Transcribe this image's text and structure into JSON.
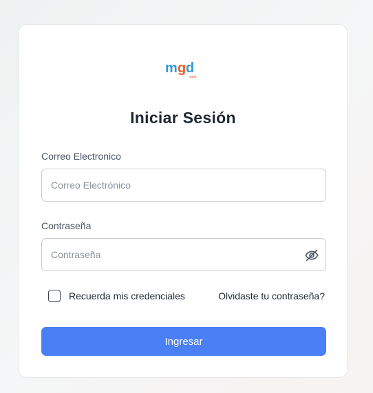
{
  "logo": {
    "text_m": "m",
    "text_g": "g",
    "text_d": "d",
    "suffix": "suite",
    "color_blue": "#2f9bd6",
    "color_orange": "#f05a28"
  },
  "login": {
    "title": "Iniciar Sesión",
    "email_label": "Correo Electronico",
    "email_placeholder": "Correo Electrónico",
    "password_label": "Contraseña",
    "password_placeholder": "Contraseña",
    "password_toggle_icon": "eye-off-icon",
    "remember_label": "Recuerda mis credenciales",
    "remember_checked": false,
    "forgot_link": "Olvidaste tu contraseña?",
    "submit_label": "Ingresar",
    "accent_color": "#4a7ff5"
  }
}
